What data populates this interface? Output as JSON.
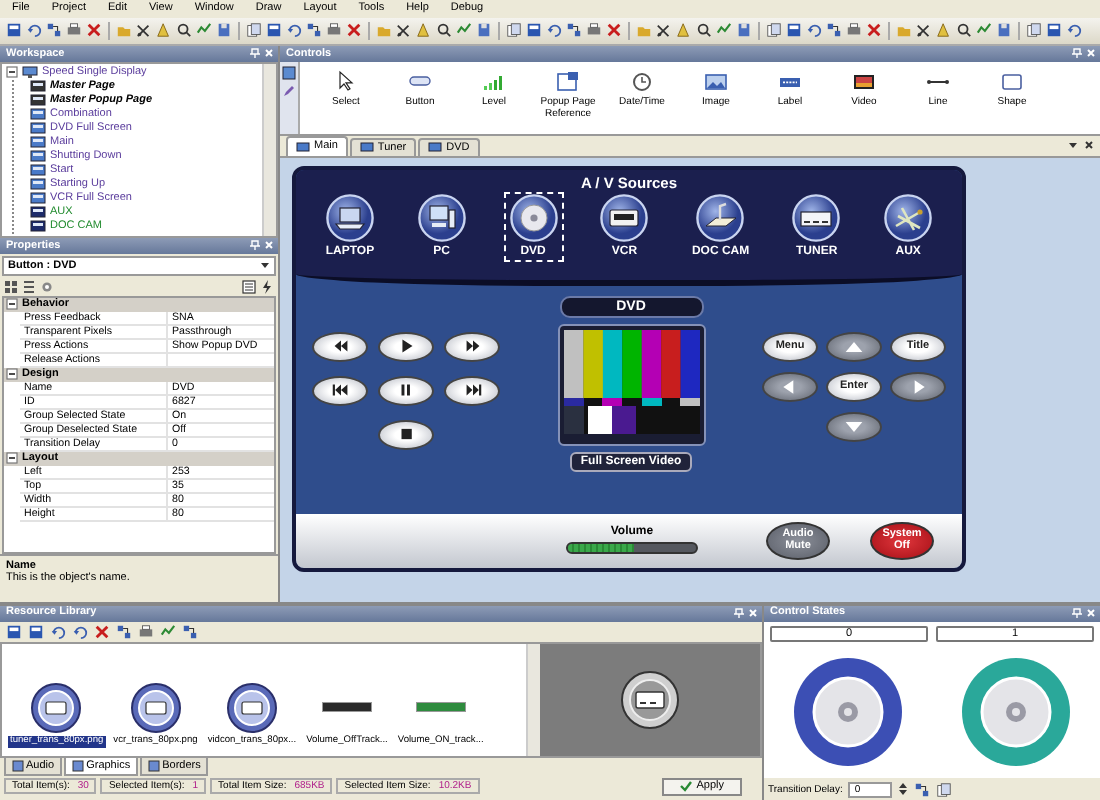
{
  "menu": [
    "File",
    "Project",
    "Edit",
    "View",
    "Window",
    "Draw",
    "Layout",
    "Tools",
    "Help",
    "Debug"
  ],
  "workspace": {
    "title": "Workspace",
    "tree": {
      "label": "Speed Single Display",
      "expanded": true,
      "children": [
        {
          "label": "Master Page",
          "kind": "master"
        },
        {
          "label": "Master Popup Page",
          "kind": "master"
        },
        {
          "label": "Combination",
          "kind": "page"
        },
        {
          "label": "DVD Full Screen",
          "kind": "page"
        },
        {
          "label": "Main",
          "kind": "page"
        },
        {
          "label": "Shutting Down",
          "kind": "page"
        },
        {
          "label": "Start",
          "kind": "page"
        },
        {
          "label": "Starting Up",
          "kind": "page"
        },
        {
          "label": "VCR Full Screen",
          "kind": "page"
        },
        {
          "label": "AUX",
          "kind": "source"
        },
        {
          "label": "DOC CAM",
          "kind": "source"
        }
      ]
    }
  },
  "properties": {
    "title": "Properties",
    "object": "Button : DVD",
    "groups": [
      {
        "name": "Behavior",
        "expanded": true,
        "rows": [
          {
            "name": "Press Feedback",
            "value": "SNA"
          },
          {
            "name": "Transparent Pixels",
            "value": "Passthrough"
          },
          {
            "name": "Press Actions",
            "value": "Show Popup DVD"
          },
          {
            "name": "Release Actions",
            "value": ""
          }
        ]
      },
      {
        "name": "Design",
        "expanded": true,
        "rows": [
          {
            "name": "Name",
            "value": "DVD"
          },
          {
            "name": "ID",
            "value": "6827"
          },
          {
            "name": "Group Selected State",
            "value": "On"
          },
          {
            "name": "Group Deselected State",
            "value": "Off"
          },
          {
            "name": "Transition Delay",
            "value": "0"
          }
        ]
      },
      {
        "name": "Layout",
        "expanded": true,
        "rows": [
          {
            "name": "Left",
            "value": "253"
          },
          {
            "name": "Top",
            "value": "35"
          },
          {
            "name": "Width",
            "value": "80"
          },
          {
            "name": "Height",
            "value": "80"
          }
        ]
      }
    ],
    "description_title": "Name",
    "description": "This is the object's name."
  },
  "controls": {
    "title": "Controls",
    "tools": [
      "Select",
      "Button",
      "Level",
      "Popup Page Reference",
      "Date/Time",
      "Image",
      "Label",
      "Video",
      "Line",
      "Shape"
    ]
  },
  "tabs": [
    {
      "label": "Main",
      "selected": true
    },
    {
      "label": "Tuner",
      "selected": false
    },
    {
      "label": "DVD",
      "selected": false
    }
  ],
  "panel": {
    "heading": "A / V Sources",
    "sources": [
      {
        "label": "LAPTOP",
        "selected": false
      },
      {
        "label": "PC",
        "selected": false
      },
      {
        "label": "DVD",
        "selected": true
      },
      {
        "label": "VCR",
        "selected": false
      },
      {
        "label": "DOC CAM",
        "selected": false
      },
      {
        "label": "TUNER",
        "selected": false
      },
      {
        "label": "AUX",
        "selected": false
      }
    ],
    "display_title": "DVD",
    "full_screen": "Full Screen Video",
    "nav": [
      {
        "label": "Menu"
      },
      {
        "label": "Title"
      },
      {
        "label": "Enter"
      }
    ],
    "volume": {
      "label": "Volume",
      "level": 0.52
    },
    "mute": "Audio Mute",
    "power": "System Off"
  },
  "resource_library": {
    "title": "Resource Library",
    "items": [
      {
        "name": "tuner_trans_80px.png",
        "kind": "round",
        "selected": true
      },
      {
        "name": "vcr_trans_80px.png",
        "kind": "round",
        "selected": false
      },
      {
        "name": "vidcon_trans_80px...",
        "kind": "round",
        "selected": false
      },
      {
        "name": "Volume_OffTrack...",
        "kind": "bar",
        "color": "#2a2a2a",
        "selected": false
      },
      {
        "name": "Volume_ON_track...",
        "kind": "bar",
        "color": "#2e8b3e",
        "selected": false
      }
    ],
    "tabs": [
      {
        "label": "Audio",
        "selected": false
      },
      {
        "label": "Graphics",
        "selected": true
      },
      {
        "label": "Borders",
        "selected": false
      }
    ],
    "status": [
      {
        "label": "Total Item(s):",
        "value": "30"
      },
      {
        "label": "Selected Item(s):",
        "value": "1"
      },
      {
        "label": "Total Item Size:",
        "value": "685KB"
      },
      {
        "label": "Selected Item Size:",
        "value": "10.2KB"
      }
    ],
    "apply": "Apply"
  },
  "control_states": {
    "title": "Control States",
    "states": [
      {
        "label": "0",
        "color": "#3c4fb4"
      },
      {
        "label": "1",
        "color": "#2aa89a"
      }
    ],
    "transition_label": "Transition Delay:",
    "transition_value": "0"
  }
}
